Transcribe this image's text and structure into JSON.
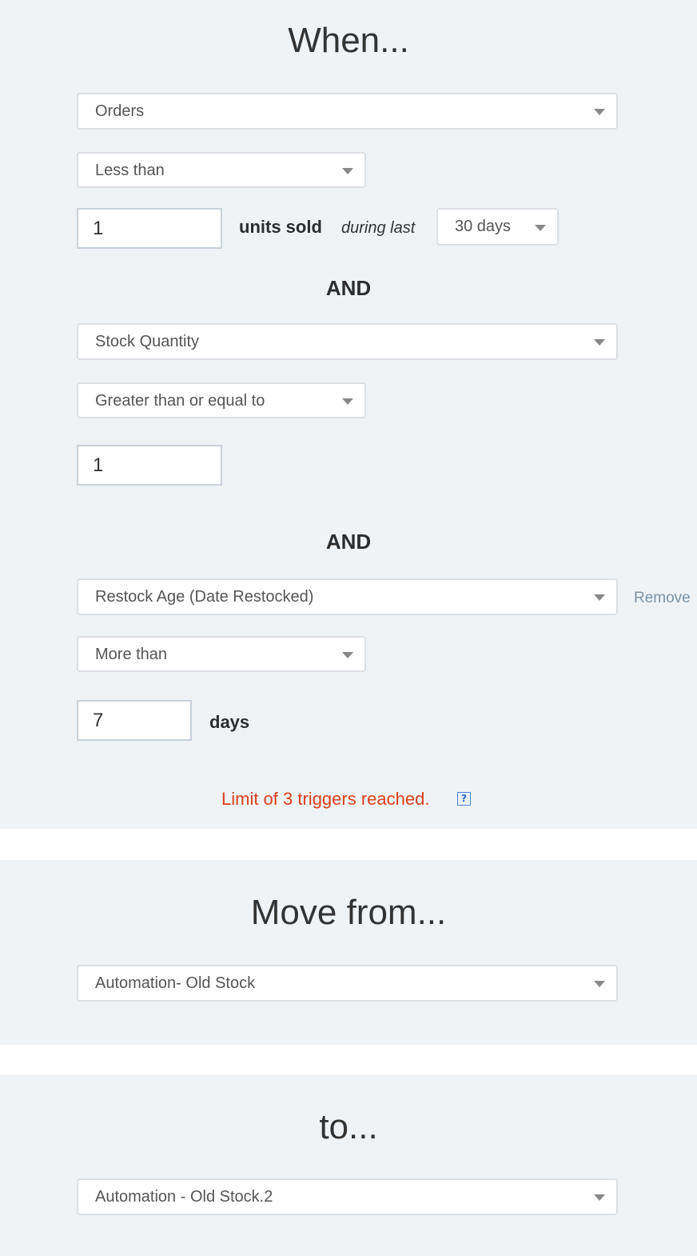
{
  "when": {
    "heading": "When...",
    "trigger1": {
      "metric": "Orders",
      "operator": "Less than",
      "value": "1",
      "unit_label": "units sold",
      "period_label": "during last",
      "period": "30 days"
    },
    "and_label_1": "AND",
    "trigger2": {
      "metric": "Stock Quantity",
      "operator": "Greater than or equal to",
      "value": "1"
    },
    "and_label_2": "AND",
    "trigger3": {
      "metric": "Restock Age (Date Restocked)",
      "remove_label": "Remove",
      "operator": "More than",
      "value": "7",
      "unit_label": "days"
    },
    "limit_message": "Limit of 3 triggers reached.",
    "help_icon_glyph": "?"
  },
  "move_from": {
    "heading": "Move from...",
    "selected": "Automation- Old Stock"
  },
  "to": {
    "heading": "to...",
    "selected": "Automation - Old Stock.2"
  },
  "colors": {
    "panel_bg": "#f0f3f6",
    "error_text": "#d9401b",
    "link_text": "#7c93a6"
  }
}
